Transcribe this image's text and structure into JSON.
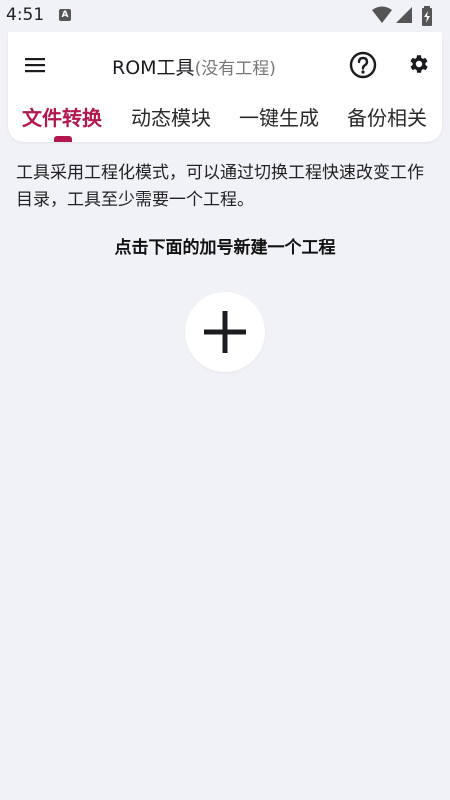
{
  "status_bar": {
    "time": "4:51",
    "notification_icon": "a-letter-icon",
    "notification_letter": "A",
    "icons": [
      "wifi-icon",
      "signal-icon",
      "battery-charging-icon"
    ]
  },
  "app_bar": {
    "title": "ROM工具",
    "subtitle": "(没有工程)",
    "menu_icon": "hamburger-menu-icon",
    "help_icon": "help-circle-icon",
    "settings_icon": "gear-icon"
  },
  "tabs": [
    {
      "label": "文件转换",
      "active": true
    },
    {
      "label": "动态模块",
      "active": false
    },
    {
      "label": "一键生成",
      "active": false
    },
    {
      "label": "备份相关",
      "active": false
    }
  ],
  "content": {
    "intro": "工具采用工程化模式，可以通过切换工程快速改变工作目录，工具至少需要一个工程。",
    "instruction": "点击下面的加号新建一个工程",
    "add_icon": "plus-icon"
  },
  "colors": {
    "accent": "#b3174f",
    "background": "#f1f2f7",
    "card": "#ffffff"
  }
}
